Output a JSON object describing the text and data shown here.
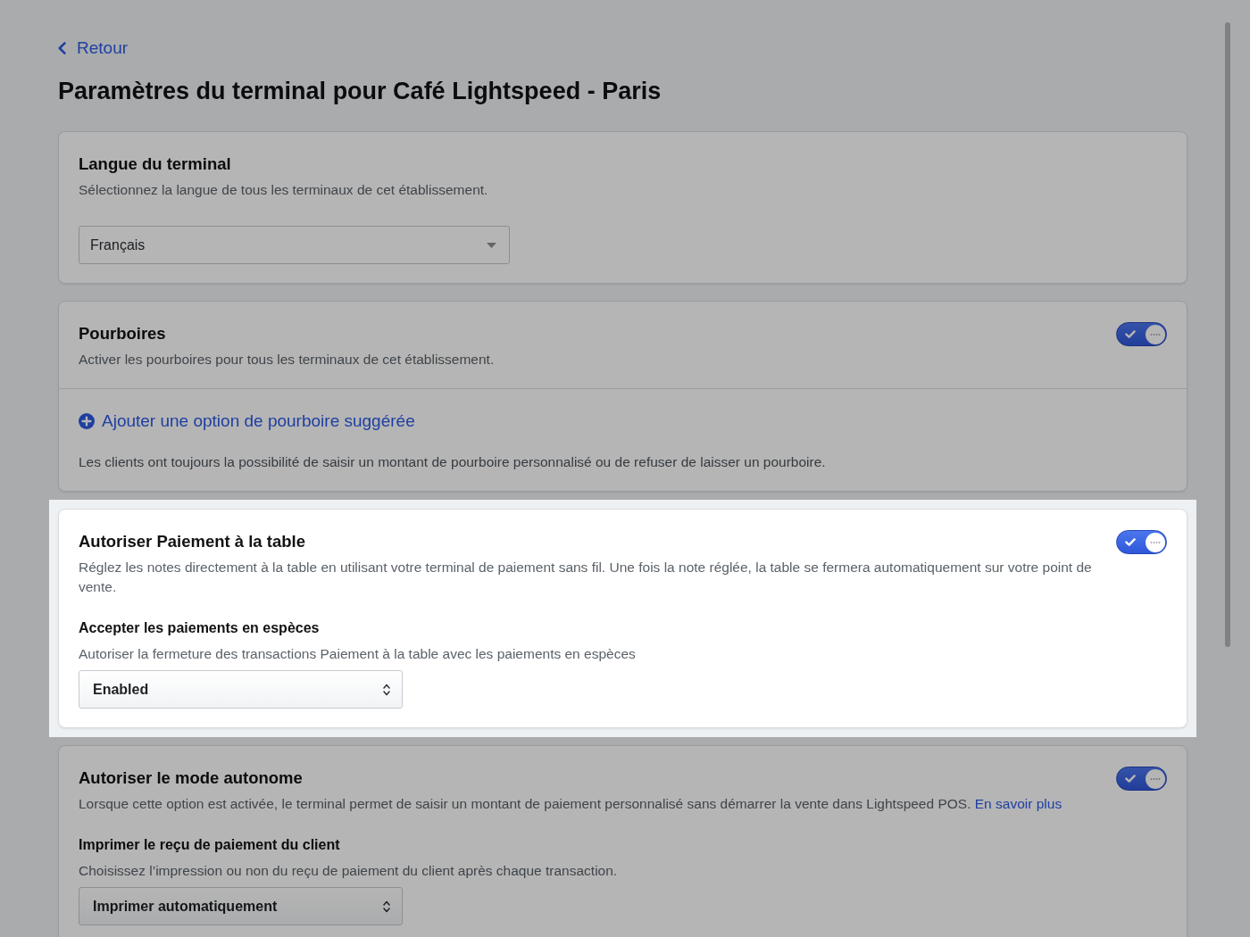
{
  "back_link": {
    "label": "Retour"
  },
  "page_title": "Paramètres du terminal pour Café Lightspeed - Paris",
  "sections": [
    {
      "title": "Langue du terminal",
      "description": "Sélectionnez la langue de tous les terminaux de cet établissement.",
      "highlighted": false,
      "select": {
        "kind": "dropdown",
        "value": "Français"
      }
    },
    {
      "title": "Pourboires",
      "description": "Activer les pourboires pour tous les terminaux de cet établissement.",
      "highlighted": false,
      "toggle": {
        "on": true
      },
      "footer": {
        "add_link": "Ajouter une option de pourboire suggérée",
        "note": "Les clients ont toujours la possibilité de saisir un montant de pourboire personnalisé ou de refuser de laisser un pourboire."
      }
    },
    {
      "title": "Autoriser Paiement à la table",
      "description": "Réglez les notes directement à la table en utilisant votre terminal de paiement sans fil. Une fois la note réglée, la table se fermera automatiquement sur votre point de vente.",
      "highlighted": true,
      "toggle": {
        "on": true
      },
      "subsetting": {
        "title": "Accepter les paiements en espèces",
        "description": "Autoriser la fermeture des transactions Paiement à la table avec les paiements en espèces",
        "select": {
          "kind": "stepper",
          "value": "Enabled"
        }
      }
    },
    {
      "title": "Autoriser le mode autonome",
      "description": "Lorsque cette option est activée, le terminal permet de saisir un montant de paiement personnalisé sans démarrer la vente dans Lightspeed POS.",
      "link": "En savoir plus",
      "highlighted": false,
      "toggle": {
        "on": true
      },
      "subsetting": {
        "title": "Imprimer le reçu de paiement du client",
        "description": "Choisissez l’impression ou non du reçu de paiement du client après chaque transaction.",
        "select": {
          "kind": "stepper",
          "value": "Imprimer automatiquement"
        }
      }
    }
  ]
}
